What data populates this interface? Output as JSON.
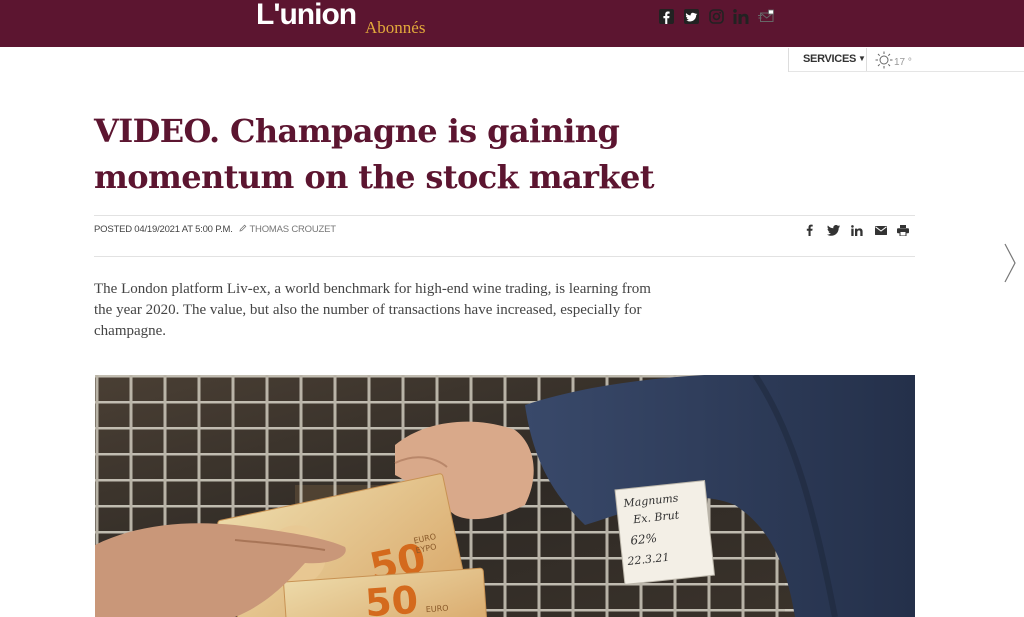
{
  "site": {
    "logo": "L'union",
    "logo_sub": "Abonnés",
    "brand_color": "#5c1530",
    "accent_color": "#e2a93b"
  },
  "utility": {
    "social_icons": [
      "facebook-icon",
      "twitter-icon",
      "instagram-icon",
      "linkedin-icon",
      "newsletter-icon"
    ],
    "services_label": "SERVICES",
    "weather_icon": "sun-icon",
    "weather_temp": "17 °"
  },
  "article": {
    "title": "VIDEO. Champagne is gaining momentum on the stock market",
    "posted": "POSTED 04/19/2021 AT 5:00 P.M.",
    "author": "THOMAS CROUZET",
    "share_icons": [
      "facebook-icon",
      "twitter-icon",
      "linkedin-icon",
      "mail-icon",
      "print-icon"
    ],
    "lede": "The London platform Liv-ex, a world benchmark for high-end wine trading, is learning from the year 2020. The value, but also the number of transactions have increased, especially for champagne."
  },
  "photo": {
    "note_lines": [
      "Magnums",
      "Ex. Brut",
      "62%",
      "22.3.21"
    ],
    "banknote_value": "50",
    "banknote_currency": "EURO",
    "banknote_currency_alt": "EYPO"
  },
  "nav": {
    "next_icon": "chevron-right-icon"
  }
}
